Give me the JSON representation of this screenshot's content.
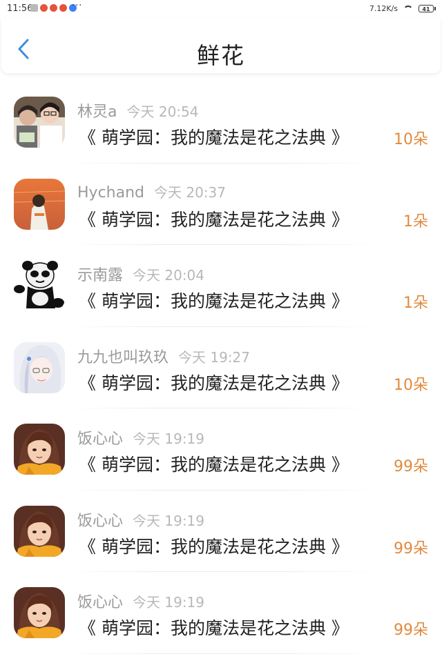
{
  "statusbar": {
    "time": "11:56",
    "more": "···",
    "speed": "7.12K/s",
    "battery": "41"
  },
  "navbar": {
    "title": "鲜花"
  },
  "colors": {
    "accent_blue": "#3b8ee0",
    "amount_orange": "#e08a3d",
    "username_gray": "#9a9a9a",
    "time_gray": "#b8b8b8"
  },
  "items": [
    {
      "user": "林灵a",
      "time": "今天 20:54",
      "book": "《 萌学园：我的魔法是花之法典 》",
      "amount": "10朵",
      "avatar": "avatar-photo-girls"
    },
    {
      "user": "Hychand",
      "time": "今天 20:37",
      "book": "《 萌学园：我的魔法是花之法典 》",
      "amount": "1朵",
      "avatar": "avatar-sunset-girl"
    },
    {
      "user": "示南露",
      "time": "今天 20:04",
      "book": "《 萌学园：我的魔法是花之法典 》",
      "amount": "1朵",
      "avatar": "avatar-panda"
    },
    {
      "user": "九九也叫玖玖",
      "time": "今天 19:27",
      "book": "《 萌学园：我的魔法是花之法典 》",
      "amount": "10朵",
      "avatar": "avatar-anime-white-hair"
    },
    {
      "user": "饭心心",
      "time": "今天 19:19",
      "book": "《 萌学园：我的魔法是花之法典 》",
      "amount": "99朵",
      "avatar": "avatar-anime-girl-scarf"
    },
    {
      "user": "饭心心",
      "time": "今天 19:19",
      "book": "《 萌学园：我的魔法是花之法典 》",
      "amount": "99朵",
      "avatar": "avatar-anime-girl-scarf"
    },
    {
      "user": "饭心心",
      "time": "今天 19:19",
      "book": "《 萌学园：我的魔法是花之法典 》",
      "amount": "99朵",
      "avatar": "avatar-anime-girl-scarf"
    }
  ]
}
